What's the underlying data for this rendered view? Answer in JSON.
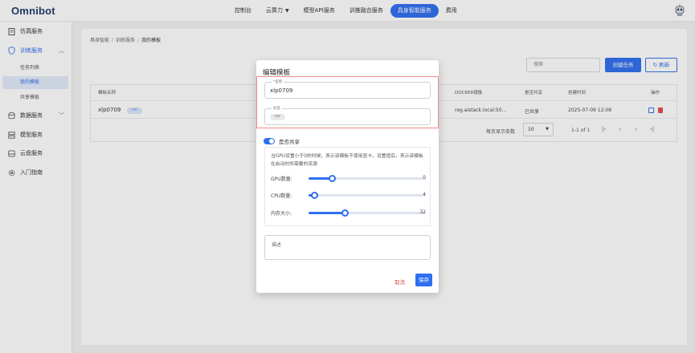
{
  "app": {
    "logo": "Omnibot"
  },
  "topnav": {
    "items": [
      {
        "label": "控制台"
      },
      {
        "label": "云算力"
      },
      {
        "label": "模型API服务"
      },
      {
        "label": "训推融合服务"
      },
      {
        "label": "具身智能服务"
      },
      {
        "label": "费用"
      }
    ],
    "active_index": 4,
    "accent": "#2f6ff0"
  },
  "sidebar": {
    "items": [
      {
        "label": "仿真服务",
        "icon": "document-icon"
      },
      {
        "label": "训练服务",
        "icon": "shield-icon",
        "expanded": true,
        "children": [
          "任务列表",
          "我的模板",
          "共享模板"
        ],
        "selected_child": 1
      },
      {
        "label": "数据服务",
        "icon": "database-icon"
      },
      {
        "label": "模型服务",
        "icon": "server-icon"
      },
      {
        "label": "云盘服务",
        "icon": "cloud-disk-icon"
      },
      {
        "label": "入门指南",
        "icon": "gear-icon"
      }
    ]
  },
  "breadcrumb": [
    "具身智能",
    "训练服务",
    "我的模板"
  ],
  "toolbar": {
    "search_placeholder": "搜索",
    "create_label": "创建任务",
    "refresh_label": "刷新"
  },
  "table": {
    "headers": [
      "模板名称",
      "DOCKER镜像",
      "是否共享",
      "创建时间",
      "操作"
    ],
    "rows": [
      {
        "name": "xlp0709",
        "tag": "rrrr",
        "image": "reg.aistack.local:50...",
        "shared": "已共享",
        "created": "2025-07-09 12:08"
      }
    ],
    "pager": {
      "per_page_label": "每页显示条数",
      "per_page": "10",
      "range": "1-1 of 1"
    }
  },
  "modal": {
    "title": "编辑模板",
    "name_label": "名称",
    "name_value": "xlp0709",
    "tag_label": "标签",
    "tag_value": "rrrr",
    "share_label": "是否共享",
    "share_on": true,
    "note": "当GPU设置小于0的时候，表示该模板不使用显卡，设置值后，表示该模板在启动时所需要的资源",
    "sliders": [
      {
        "label": "GPU数量:",
        "value": "0",
        "fraction": 0.2
      },
      {
        "label": "CPU数量:",
        "value": "4",
        "fraction": 0.05
      },
      {
        "label": "内存大小:",
        "value": "32",
        "fraction": 0.31
      }
    ],
    "desc_placeholder": "描述",
    "cancel_label": "取消",
    "save_label": "保存"
  }
}
